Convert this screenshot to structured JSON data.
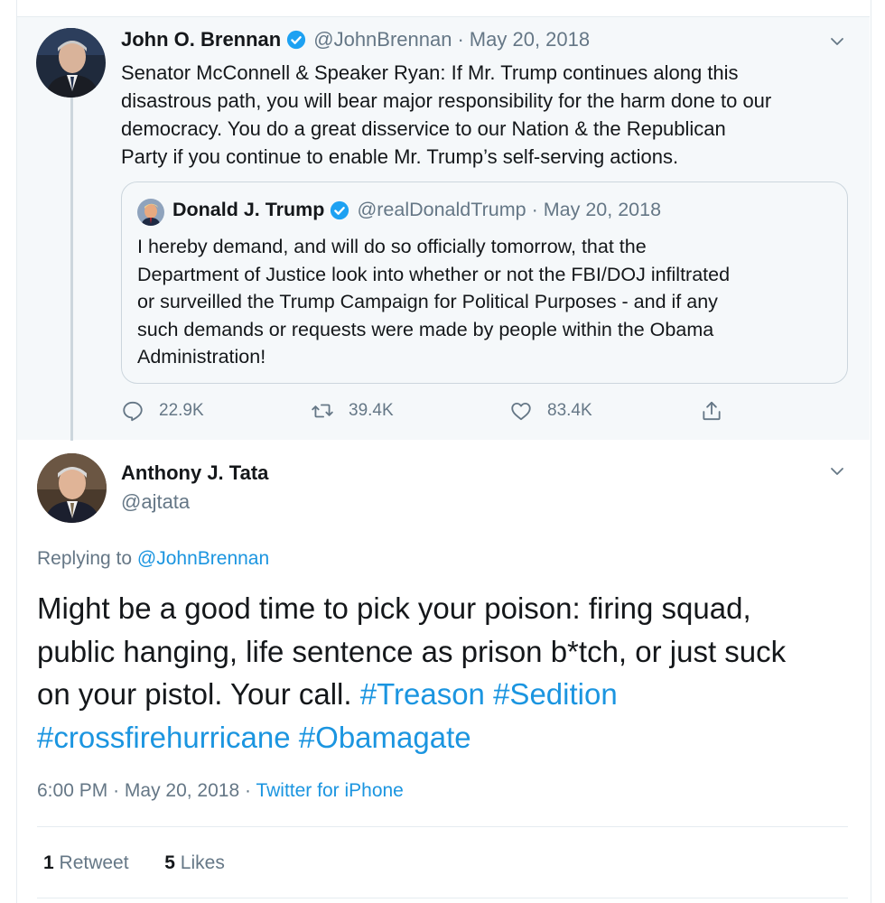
{
  "parent_tweet": {
    "name": "John O. Brennan",
    "handle": "@JohnBrennan",
    "date": "May 20, 2018",
    "text_lines": [
      "Senator McConnell & Speaker Ryan: If Mr. Trump continues along this",
      "disastrous path, you will bear major responsibility for the harm done to our",
      "democracy. You do a great disservice to our Nation & the Republican",
      "Party if you continue to enable Mr. Trump’s self-serving actions."
    ],
    "quoted": {
      "name": "Donald J. Trump",
      "handle": "@realDonaldTrump",
      "date": "May 20, 2018",
      "text_lines": [
        "I hereby demand, and will do so officially tomorrow, that the",
        "Department of Justice look into whether or not the FBI/DOJ infiltrated",
        "or surveilled the Trump Campaign for Political Purposes - and if any",
        "such demands or requests were made by people within the Obama",
        "Administration!"
      ]
    },
    "actions": {
      "replies": "22.9K",
      "retweets": "39.4K",
      "likes": "83.4K"
    }
  },
  "main_tweet": {
    "name": "Anthony J. Tata",
    "handle": "@ajtata",
    "replying_prefix": "Replying to",
    "replying_to": "@JohnBrennan",
    "text_line1": "Might be a good time to pick your poison: firing squad,",
    "text_line2": "public hanging, life sentence as prison b*tch, or just suck",
    "text_line3_plain": "on your pistol. Your call.",
    "hashtag1": "#Treason",
    "hashtag2": "#Sedition",
    "hashtag3": "#crossfirehurricane",
    "hashtag4": "#Obamagate",
    "time": "6:00 PM",
    "date": "May 20, 2018",
    "source": "Twitter for iPhone",
    "retweet_count": "1",
    "retweet_label": "Retweet",
    "like_count": "5",
    "like_label": "Likes"
  },
  "colors": {
    "link": "#1b95e0",
    "secondary_text": "#657786",
    "verified": "#1da1f2",
    "parent_background": "#f5f8fa"
  },
  "icons": [
    "verified-badge-icon",
    "chevron-down-icon",
    "reply-icon",
    "retweet-icon",
    "like-icon",
    "share-icon"
  ]
}
